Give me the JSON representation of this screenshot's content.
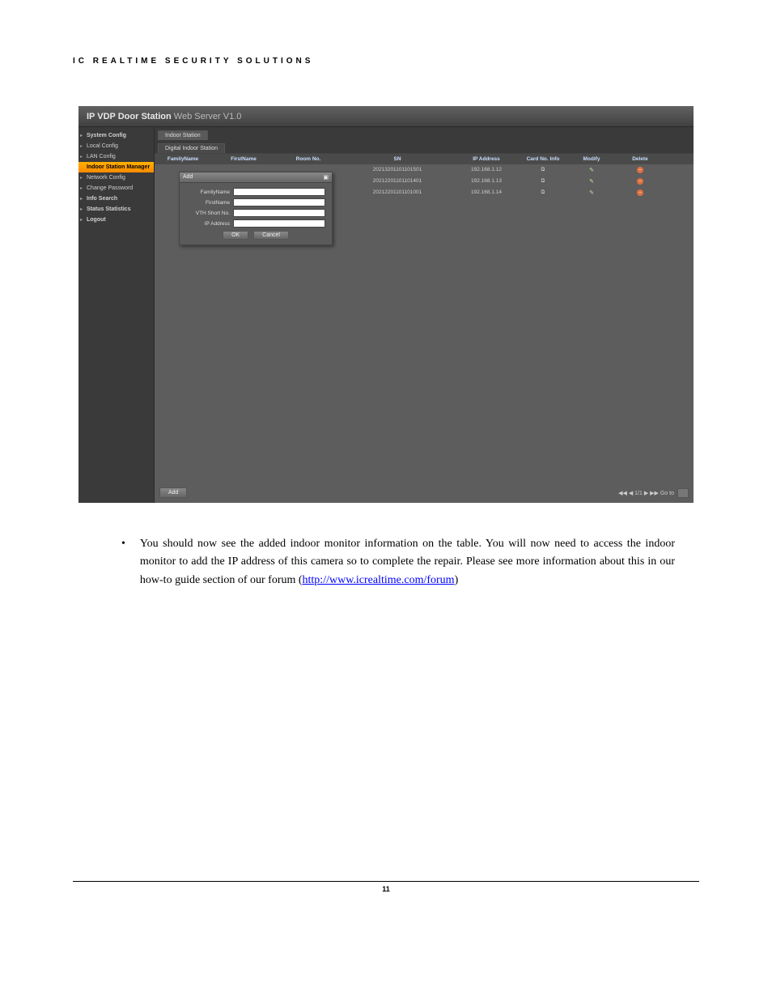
{
  "header": "IC REALTIME SECURITY SOLUTIONS",
  "app": {
    "title_strong": "IP VDP Door Station",
    "title_thin": "Web Server V1.0",
    "sidebar": [
      {
        "label": "System Config",
        "cls": "top bullet"
      },
      {
        "label": "Local Config",
        "cls": "bullet"
      },
      {
        "label": "LAN Config",
        "cls": "bullet"
      },
      {
        "label": "Indoor Station Manager",
        "cls": "selected"
      },
      {
        "label": "Network Config",
        "cls": "bullet"
      },
      {
        "label": "Change Password",
        "cls": "bullet"
      },
      {
        "label": "Info Search",
        "cls": "top bullet"
      },
      {
        "label": "Status Statistics",
        "cls": "top bullet"
      },
      {
        "label": "Logout",
        "cls": "top bullet"
      }
    ],
    "tab1": "Indoor Station",
    "tab2": "Digital Indoor Station",
    "columns": [
      "FamilyName",
      "FirstName",
      "Room No.",
      "SN",
      "IP Address",
      "Card No. Info",
      "Modify",
      "Delete"
    ],
    "rows": [
      {
        "sn": "20213201101101501",
        "ip": "192.168.1.12"
      },
      {
        "sn": "20212201101101401",
        "ip": "192.168.1.13"
      },
      {
        "sn": "20212201101101001",
        "ip": "192.168.1.14"
      }
    ],
    "modal": {
      "title": "Add",
      "fields": [
        "FamilyName",
        "FirstName",
        "VTH Short No.",
        "IP Address"
      ],
      "ok": "OK",
      "cancel": "Cancel"
    },
    "add_btn": "Add",
    "pager": "◀◀ ◀ 1/1 ▶ ▶▶ Go to"
  },
  "body_text": {
    "bullet": "You should now see the added indoor monitor information on the table. You will now need to access the indoor monitor to add the IP address of this camera so to complete the repair. Please see more information about this in our how-to guide section of our forum  (",
    "link_text": "http://www.icrealtime.com/forum",
    "link_href": "http://www.icrealtime.com/forum",
    "after": ")"
  },
  "page_number": "11"
}
